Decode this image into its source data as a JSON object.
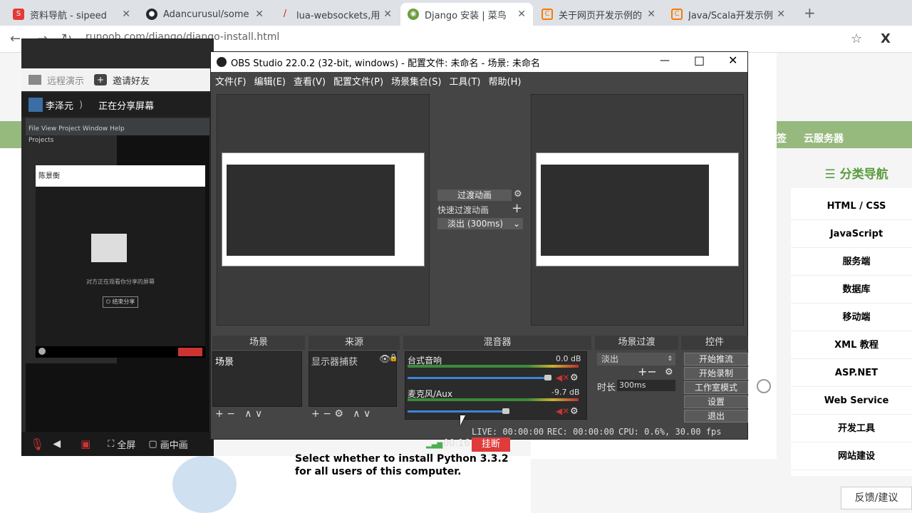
{
  "browser": {
    "tabs": [
      {
        "title": "资料导航 - sipeed",
        "favicon": "s-icon",
        "color": "#e53935"
      },
      {
        "title": "Adancurusul/some",
        "favicon": "github-icon",
        "color": "#24292e"
      },
      {
        "title": "lua-websockets,用",
        "favicon": "lua-icon",
        "color": "#c62828"
      },
      {
        "title": "Django 安装 | 菜鸟",
        "favicon": "runoob-icon",
        "color": "#6a9e3d"
      },
      {
        "title": "关于网页开发示例的",
        "favicon": "csdn-icon",
        "color": "#f57c00"
      },
      {
        "title": "Java/Scala开发示例",
        "favicon": "csdn-icon",
        "color": "#f57c00"
      }
    ],
    "url": "runoob.com/django/django-install.html"
  },
  "site": {
    "nav_cloud": "云服务器",
    "sidebar_title": "☰ 分类导航",
    "sidebar_items": [
      "HTML / CSS",
      "JavaScript",
      "服务端",
      "数据库",
      "移动端",
      "XML 教程",
      "ASP.NET",
      "Web Service",
      "开发工具",
      "网站建设"
    ],
    "feedback": "反馈/建议",
    "pdf_line1": "Select whether to install Python 3.3.2",
    "pdf_line2": "for all users of this computer."
  },
  "meeting": {
    "remote_demo": "远程演示",
    "invite": "邀请好友",
    "user_name": "李泽元",
    "sharing": "正在分享屏幕",
    "shared_panel_title": "Projects",
    "shared_user": "陈景衡",
    "shared_hint": "对方正在观看你分享的屏幕",
    "shared_stop": "结束分享",
    "bottom_fullscreen": "全屏",
    "bottom_pip": "画中画",
    "timer": "00:16",
    "hangup": "挂断"
  },
  "obs": {
    "title": "OBS Studio 22.0.2 (32-bit, windows) - 配置文件: 未命名 - 场景: 未命名",
    "menu": [
      "文件(F)",
      "编辑(E)",
      "查看(V)",
      "配置文件(P)",
      "场景集合(S)",
      "工具(T)",
      "帮助(H)"
    ],
    "transition_btn": "过渡动画",
    "quick_transition": "快速过渡动画",
    "fade_select": "淡出 (300ms)",
    "docks": {
      "scenes": "场景",
      "sources": "来源",
      "mixer": "混音器",
      "transitions": "场景过渡",
      "controls": "控件"
    },
    "scene_item": "场景",
    "source_item": "显示器捕获",
    "mixer": [
      {
        "name": "台式音响",
        "db": "0.0 dB",
        "level": 0.9
      },
      {
        "name": "麦克风/Aux",
        "db": "-9.7 dB",
        "level": 0.8
      }
    ],
    "transition_select": "淡出",
    "duration_label": "时长",
    "duration_value": "300ms",
    "controls": [
      "开始推流",
      "开始录制",
      "工作室模式",
      "设置",
      "退出"
    ],
    "status": {
      "live": "LIVE: 00:00:00",
      "rec": "REC: 00:00:00",
      "cpu": "CPU: 0.6%, 30.00 fps"
    }
  }
}
